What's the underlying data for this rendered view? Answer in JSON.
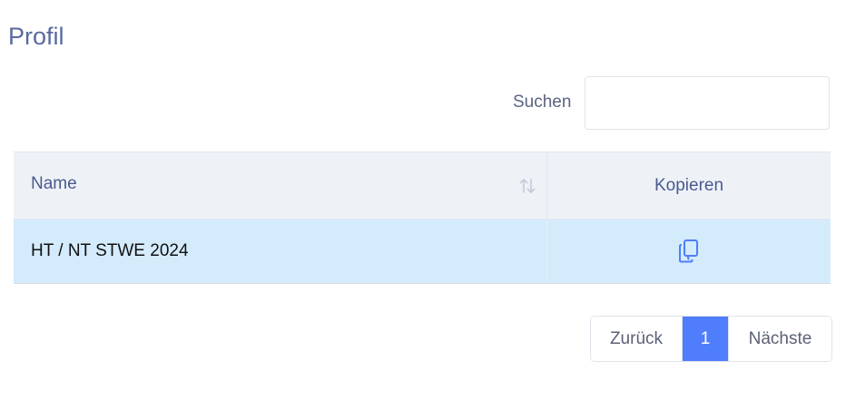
{
  "page": {
    "title": "Profil"
  },
  "search": {
    "label": "Suchen",
    "value": "",
    "placeholder": ""
  },
  "table": {
    "columns": [
      {
        "label": "Name",
        "sortable": true,
        "sort_icon": "sort-icon"
      },
      {
        "label": "Kopieren",
        "sortable": false
      }
    ],
    "rows": [
      {
        "name": "HT / NT STWE 2024",
        "action_icon": "copy-icon"
      }
    ]
  },
  "pagination": {
    "prev_label": "Zurück",
    "pages": [
      "1"
    ],
    "current_page": "1",
    "next_label": "Nächste"
  },
  "colors": {
    "accent": "#4f7dfc",
    "title": "#5a6aa0",
    "row_highlight": "#d4ebfb",
    "header_bg": "#eef2f7"
  }
}
